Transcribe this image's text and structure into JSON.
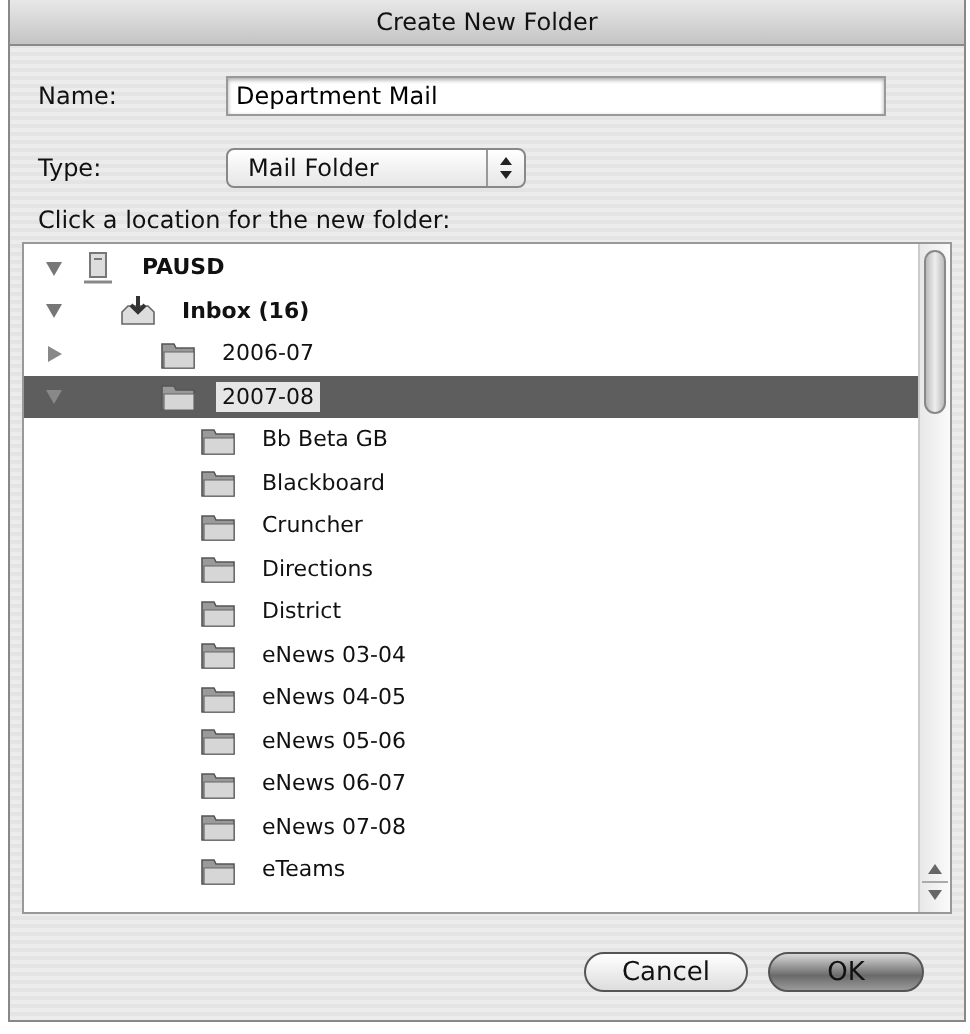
{
  "window": {
    "title": "Create New Folder"
  },
  "name_field": {
    "label": "Name:",
    "value": "Department Mail"
  },
  "type_field": {
    "label": "Type:",
    "value": "Mail Folder"
  },
  "location_prompt": "Click a location for the new folder:",
  "tree": [
    {
      "label": "PAUSD",
      "kind": "server",
      "bold": true,
      "expanded": true,
      "selected": false,
      "children": [
        {
          "label": "Inbox (16)",
          "kind": "inbox",
          "bold": true,
          "expanded": true,
          "selected": false,
          "children": [
            {
              "label": "2006-07",
              "kind": "folder",
              "bold": false,
              "expanded": false,
              "selected": false,
              "has_children": true
            },
            {
              "label": "2007-08",
              "kind": "folder",
              "bold": false,
              "expanded": true,
              "selected": true,
              "children": [
                {
                  "label": "Bb Beta GB",
                  "kind": "folder",
                  "bold": false,
                  "selected": false
                },
                {
                  "label": "Blackboard",
                  "kind": "folder",
                  "bold": false,
                  "selected": false
                },
                {
                  "label": "Cruncher",
                  "kind": "folder",
                  "bold": false,
                  "selected": false
                },
                {
                  "label": "Directions",
                  "kind": "folder",
                  "bold": false,
                  "selected": false
                },
                {
                  "label": "District",
                  "kind": "folder",
                  "bold": false,
                  "selected": false
                },
                {
                  "label": "eNews 03-04",
                  "kind": "folder",
                  "bold": false,
                  "selected": false
                },
                {
                  "label": "eNews 04-05",
                  "kind": "folder",
                  "bold": false,
                  "selected": false
                },
                {
                  "label": "eNews 05-06",
                  "kind": "folder",
                  "bold": false,
                  "selected": false
                },
                {
                  "label": "eNews 06-07",
                  "kind": "folder",
                  "bold": false,
                  "selected": false
                },
                {
                  "label": "eNews 07-08",
                  "kind": "folder",
                  "bold": false,
                  "selected": false
                },
                {
                  "label": "eTeams",
                  "kind": "folder",
                  "bold": false,
                  "selected": false
                }
              ]
            }
          ]
        }
      ]
    }
  ],
  "buttons": [
    {
      "label": "Cancel",
      "default": false
    },
    {
      "label": "OK",
      "default": true
    }
  ]
}
